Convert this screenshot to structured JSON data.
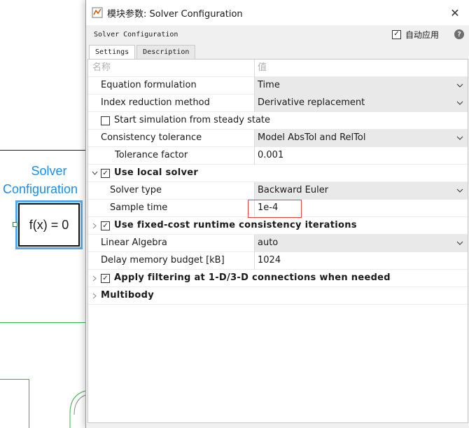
{
  "canvas": {
    "block_title_line1": "Solver",
    "block_title_line2": "Configuration",
    "block_body_text": "f(x) = 0"
  },
  "dialog": {
    "title": "模块参数: Solver Configuration",
    "block_name": "Solver Configuration",
    "auto_apply_label": "自动应用",
    "auto_apply_checked": true,
    "help_glyph": "?",
    "close_glyph": "✕",
    "tabs": [
      "Settings",
      "Description"
    ],
    "active_tab": "Settings",
    "column_headers": {
      "name": "名称",
      "value": "值"
    },
    "params": {
      "equation_formulation": {
        "label": "Equation formulation",
        "value": "Time"
      },
      "index_reduction": {
        "label": "Index reduction method",
        "value": "Derivative replacement"
      },
      "start_steady_state": {
        "label": "Start simulation from steady state",
        "checked": false
      },
      "consistency_tolerance": {
        "label": "Consistency tolerance",
        "value": "Model AbsTol and RelTol"
      },
      "tolerance_factor": {
        "label": "Tolerance factor",
        "value": "0.001"
      },
      "use_local_solver": {
        "label": "Use local solver",
        "checked": true,
        "expanded": true
      },
      "solver_type": {
        "label": "Solver type",
        "value": "Backward Euler"
      },
      "sample_time": {
        "label": "Sample time",
        "value": "1e-4"
      },
      "fixed_cost": {
        "label": "Use fixed-cost runtime consistency iterations",
        "checked": true,
        "expanded": false
      },
      "linear_algebra": {
        "label": "Linear Algebra",
        "value": "auto"
      },
      "delay_memory": {
        "label": "Delay memory budget [kB]",
        "value": "1024"
      },
      "apply_filtering": {
        "label": "Apply filtering at 1-D/3-D connections when needed",
        "checked": true,
        "expanded": false
      },
      "multibody": {
        "label": "Multibody",
        "expanded": false
      }
    }
  },
  "colors": {
    "accent_blue": "#1b8ee3",
    "signal_green": "#38b34a",
    "highlight_red": "#e34444"
  }
}
